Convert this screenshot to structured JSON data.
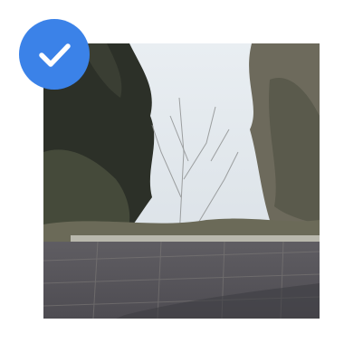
{
  "tile": {
    "selected": true,
    "selection_icon": "check-icon",
    "colors": {
      "badge": "#3b82e8",
      "check": "#ffffff",
      "background": "#ffffff"
    }
  },
  "photo": {
    "description_icon": "photo-thumbnail"
  }
}
